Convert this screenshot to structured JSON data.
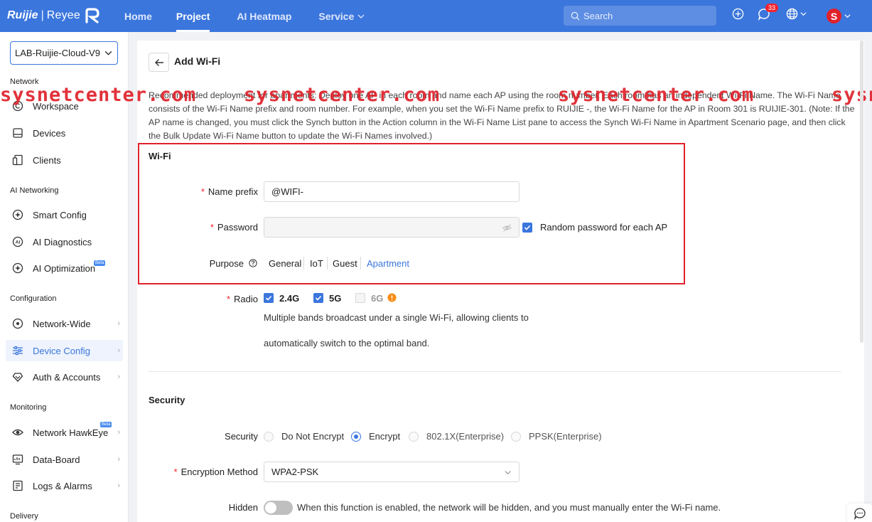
{
  "brand": {
    "logo": "Ruijie",
    "sub": "Reyee"
  },
  "nav": {
    "home": "Home",
    "project": "Project",
    "ai_heatmap": "AI Heatmap",
    "service": "Service"
  },
  "search": {
    "placeholder": "Search"
  },
  "notifications": {
    "count": "33"
  },
  "user": {
    "initial": "S"
  },
  "sidebar": {
    "project": "LAB-Ruijie-Cloud-V9",
    "sections": {
      "network": "Network",
      "ai_networking": "AI Networking",
      "configuration": "Configuration",
      "monitoring": "Monitoring",
      "delivery": "Delivery"
    },
    "items": {
      "workspace": "Workspace",
      "devices": "Devices",
      "clients": "Clients",
      "smart_config": "Smart Config",
      "ai_diagnostics": "AI Diagnostics",
      "ai_optimization": "AI Optimization",
      "network_wide": "Network-Wide",
      "device_config": "Device Config",
      "auth_accounts": "Auth & Accounts",
      "network_hawkeye": "Network HawkEye",
      "data_board": "Data-Board",
      "logs_alarms": "Logs & Alarms"
    },
    "beta": "Beta"
  },
  "page": {
    "title": "Add Wi-Fi",
    "description": "Recommended deployment for apartments: Deploy one AP in each room and name each AP using the room number. Each room has an independent Wi-Fi Name. The Wi-Fi Name consists of the Wi-Fi Name prefix and room number. For example, when you set the Wi-Fi Name prefix to RUIJIE -, the Wi-Fi Name for the AP in Room 301 is RUIJIE-301. (Note: If the AP name is changed, you must click the Synch button in the Action column in the Wi-Fi Name List pane to access the Synch Wi-Fi Name in Apartment Scenario page, and then click the Bulk Update Wi-Fi Name button to update the Wi-Fi Names involved.)"
  },
  "watermark": "sysnetcenter.com",
  "wifi": {
    "section_title": "Wi-Fi",
    "name_prefix_label": "Name prefix",
    "name_prefix_value": "@WIFI-",
    "password_label": "Password",
    "random_password_label": "Random password for each AP",
    "random_password_checked": true,
    "purpose_label": "Purpose",
    "purpose_options": [
      "General",
      "IoT",
      "Guest",
      "Apartment"
    ],
    "purpose_selected": "Apartment",
    "radio_label": "Radio",
    "radio_24": "2.4G",
    "radio_5": "5G",
    "radio_6": "6G",
    "radio_hint_1": "Multiple bands broadcast under a single Wi-Fi, allowing clients to",
    "radio_hint_2": "automatically switch to the optimal band."
  },
  "security": {
    "section_title": "Security",
    "security_label": "Security",
    "options": [
      "Do Not Encrypt",
      "Encrypt",
      "802.1X(Enterprise)",
      "PPSK(Enterprise)"
    ],
    "selected": "Encrypt",
    "encryption_label": "Encryption Method",
    "encryption_value": "WPA2-PSK",
    "hidden_label": "Hidden",
    "hidden_hint": "When this function is enabled, the network will be hidden, and you must manually enter the Wi-Fi name."
  },
  "colors": {
    "primary": "#3b76dd",
    "required": "#f5222d",
    "highlight": "#e0212b"
  }
}
